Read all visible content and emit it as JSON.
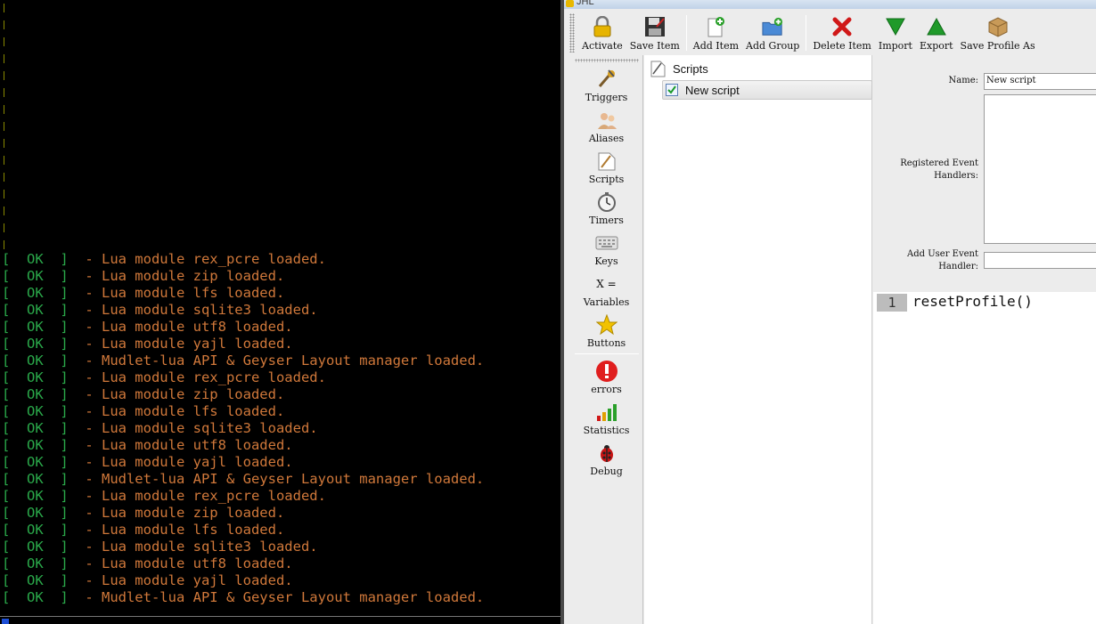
{
  "console": {
    "lines": [
      {
        "status": "[  OK  ]",
        "text": "  - Lua module rex_pcre loaded."
      },
      {
        "status": "[  OK  ]",
        "text": "  - Lua module zip loaded."
      },
      {
        "status": "[  OK  ]",
        "text": "  - Lua module lfs loaded."
      },
      {
        "status": "[  OK  ]",
        "text": "  - Lua module sqlite3 loaded."
      },
      {
        "status": "[  OK  ]",
        "text": "  - Lua module utf8 loaded."
      },
      {
        "status": "[  OK  ]",
        "text": "  - Lua module yajl loaded."
      },
      {
        "status": "[  OK  ]",
        "text": "  - Mudlet-lua API & Geyser Layout manager loaded."
      },
      {
        "status": "[  OK  ]",
        "text": "  - Lua module rex_pcre loaded."
      },
      {
        "status": "[  OK  ]",
        "text": "  - Lua module zip loaded."
      },
      {
        "status": "[  OK  ]",
        "text": "  - Lua module lfs loaded."
      },
      {
        "status": "[  OK  ]",
        "text": "  - Lua module sqlite3 loaded."
      },
      {
        "status": "[  OK  ]",
        "text": "  - Lua module utf8 loaded."
      },
      {
        "status": "[  OK  ]",
        "text": "  - Lua module yajl loaded."
      },
      {
        "status": "[  OK  ]",
        "text": "  - Mudlet-lua API & Geyser Layout manager loaded."
      },
      {
        "status": "[  OK  ]",
        "text": "  - Lua module rex_pcre loaded."
      },
      {
        "status": "[  OK  ]",
        "text": "  - Lua module zip loaded."
      },
      {
        "status": "[  OK  ]",
        "text": "  - Lua module lfs loaded."
      },
      {
        "status": "[  OK  ]",
        "text": "  - Lua module sqlite3 loaded."
      },
      {
        "status": "[  OK  ]",
        "text": "  - Lua module utf8 loaded."
      },
      {
        "status": "[  OK  ]",
        "text": "  - Lua module yajl loaded."
      },
      {
        "status": "[  OK  ]",
        "text": "  - Mudlet-lua API & Geyser Layout manager loaded."
      }
    ],
    "ok_color": "#2aa84a",
    "text_color": "#d0783a"
  },
  "window": {
    "title": "JHL"
  },
  "toolbar": {
    "activate": "Activate",
    "save_item": "Save Item",
    "add_item": "Add Item",
    "add_group": "Add Group",
    "delete_item": "Delete Item",
    "import": "Import",
    "export": "Export",
    "save_profile_as": "Save Profile As"
  },
  "sidebar": {
    "triggers": "Triggers",
    "aliases": "Aliases",
    "scripts": "Scripts",
    "timers": "Timers",
    "keys": "Keys",
    "variables_glyph": "X =",
    "variables": "Variables",
    "buttons": "Buttons",
    "errors": "errors",
    "statistics": "Statistics",
    "debug": "Debug"
  },
  "tree": {
    "root": "Scripts",
    "items": [
      {
        "label": "New script",
        "checked": true
      }
    ]
  },
  "properties": {
    "name_label": "Name:",
    "name_value": "New script",
    "handlers_label_1": "Registered Event",
    "handlers_label_2": "Handlers:",
    "add_handler_label_1": "Add User Event",
    "add_handler_label_2": "Handler:",
    "add_handler_value": ""
  },
  "code": {
    "line_number": "1",
    "line_text": "resetProfile()"
  }
}
